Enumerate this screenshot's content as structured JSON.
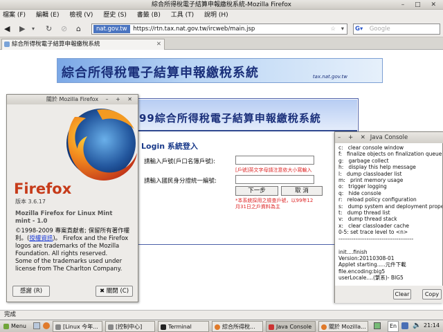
{
  "window": {
    "title": "綜合所得稅電子結算申報繳稅系統-Mozilla Firefox"
  },
  "menu": [
    "檔案 (F)",
    "編輯 (E)",
    "檢視 (V)",
    "歷史 (S)",
    "書籤 (B)",
    "工具 (T)",
    "說明 (H)"
  ],
  "nav": {
    "site_badge": "nat.gov.tw",
    "url": "https://rtn.tax.nat.gov.tw/ircweb/main.jsp",
    "search_placeholder": "Google"
  },
  "tab": {
    "label": "綜合所得稅電子結算申報繳稅系統"
  },
  "page": {
    "banner_title": "綜合所得稅電子結算申報繳稅系統",
    "banner_domain": "tax.nat.gov.tw",
    "login_header": "99綜合所得稅電子結算申報繳稅系統",
    "login_title": "Login 系統登入",
    "field1_label": "請輸入戶號(戶口名簿戶號):",
    "field1_note": "[戶號]英文字母請注意依大小寫輸入",
    "field2_label": "請輸入國民身分證統一編號:",
    "next_btn": "下一步",
    "cancel_btn": "取 消",
    "notice_line1": "*本系統採用之檢查戶號，以99年12",
    "notice_line2": "月31日之戶資料為主"
  },
  "about": {
    "title": "關於 Mozilla Firefox",
    "name": "Firefox",
    "version": "版本 3.6.17",
    "product_line1": "Mozilla Firefox for Linux Mint",
    "product_line2": "mint - 1.0",
    "copy_line1": "©1998-2009 專案貢獻者; 保留所有著作權",
    "copy_line2a": "利。(",
    "copy_link": "授權資訊",
    "copy_line2b": ")。 Firefox and the Firefox",
    "copy_line3": "logos are trademarks of the Mozilla",
    "copy_line4": "Foundation. All rights reserved.",
    "copy_line5": "Some of the trademarks used under",
    "copy_line6": "license from The Charlton Company.",
    "credits_btn": "感謝 (R)",
    "close_btn": "關閉 (C)"
  },
  "java": {
    "title": "Java Console",
    "lines": [
      "c:   clear console window",
      "f:   finalize objects on finalization queue",
      "g:   garbage collect",
      "h:   display this help message",
      "l:   dump classloader list",
      "m:   print memory usage",
      "o:   trigger logging",
      "q:   hide console",
      "r:   reload policy configuration",
      "s:   dump system and deployment properties",
      "t:   dump thread list",
      "v:   dump thread stack",
      "x:   clear classloader cache",
      "0-5: set trace level to <n>",
      "----------------------------------------",
      "",
      "init....finish",
      "Version:20110308-01",
      "Applet starting.....元件下載",
      "file.encoding:big5",
      "userLocale....(繁系)- BIG5"
    ],
    "clear_btn": "Clear",
    "copy_btn": "Copy"
  },
  "status": "完成",
  "taskbar": {
    "menu": "Menu",
    "tasks": [
      "[Linux 今年...",
      "[控制中心]",
      "Terminal",
      "綜合所得稅...",
      "Java Console",
      "關於 Mozilla..."
    ],
    "lang": "En",
    "time": "21:14"
  },
  "colors": {
    "firefox_orange": "#c63b1a",
    "banner_blue": "#1a2f7a",
    "link": "#1a3ad8"
  }
}
